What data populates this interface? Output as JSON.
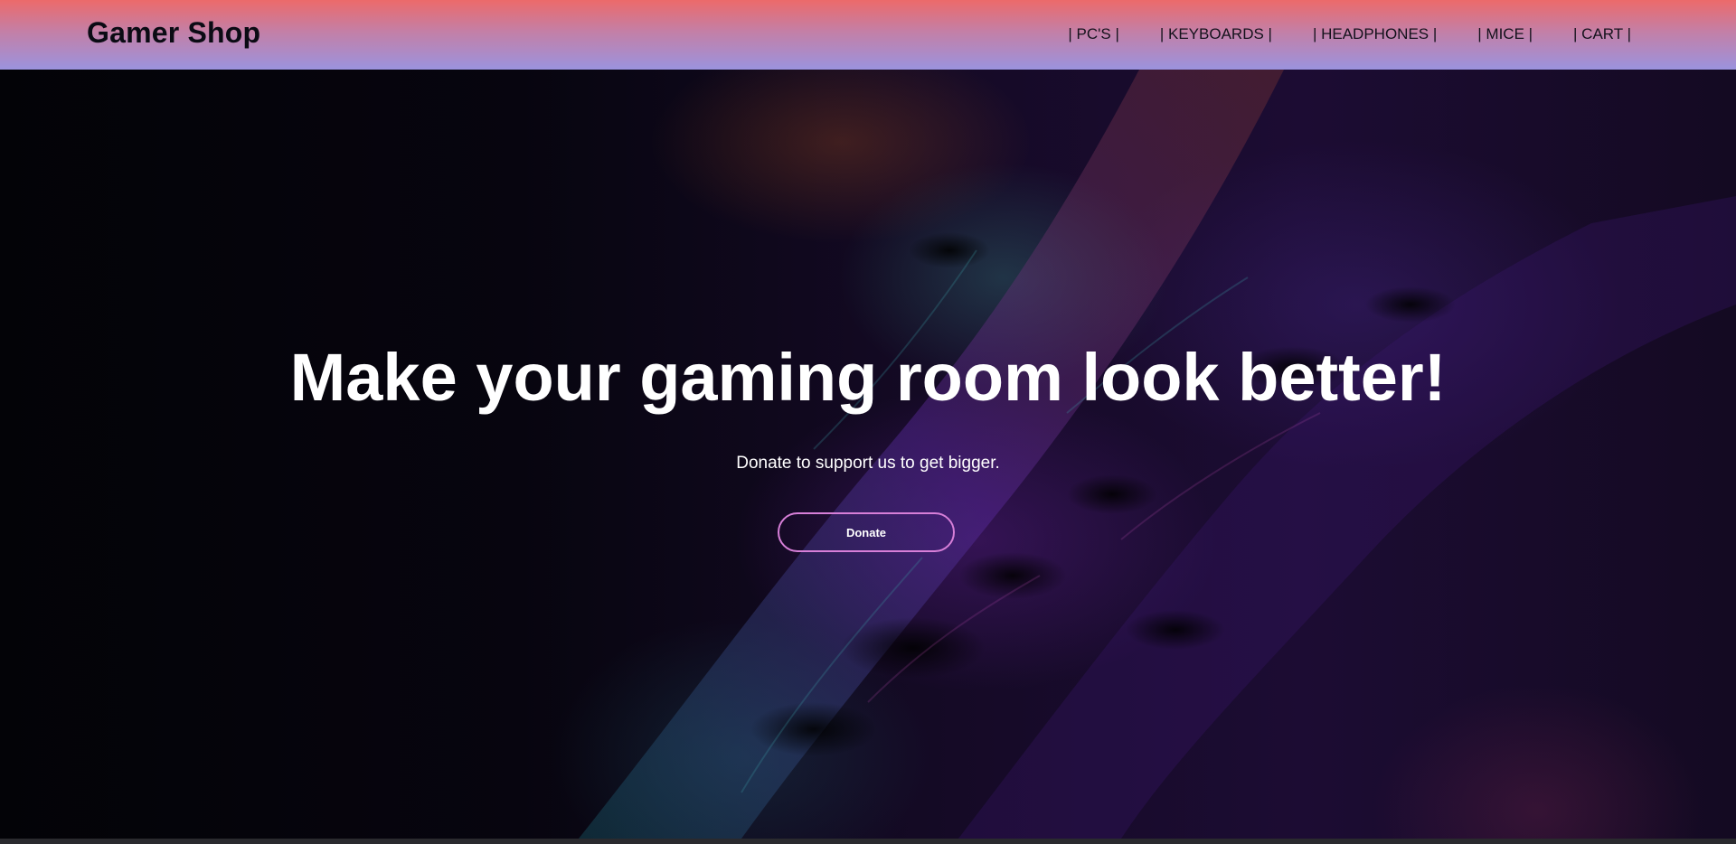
{
  "header": {
    "logo": "Gamer Shop",
    "nav": [
      {
        "label": "| PC'S |"
      },
      {
        "label": "| KEYBOARDS |"
      },
      {
        "label": "| HEADPHONES |"
      },
      {
        "label": "| MICE |"
      },
      {
        "label": "| CART |"
      }
    ]
  },
  "hero": {
    "title": "Make your gaming room look better!",
    "subtitle": "Donate to support us to get bigger.",
    "button_label": "Donate"
  },
  "colors": {
    "header_top": "#ec6a6a",
    "header_bottom": "#9b93de",
    "button_border": "#d77fd8",
    "hero_background": "#05040a"
  }
}
